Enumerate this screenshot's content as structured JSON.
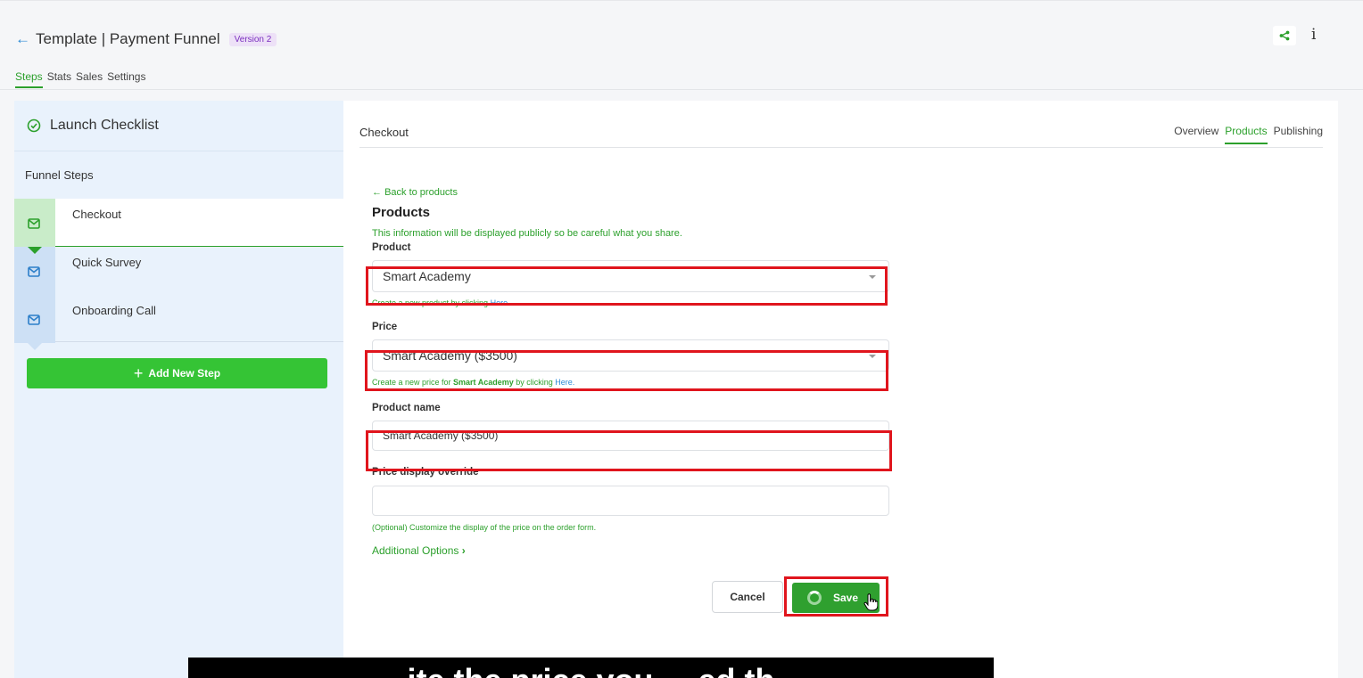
{
  "header": {
    "back_icon": "arrow-left-icon",
    "title": "Template | Payment Funnel",
    "version_badge": "Version 2",
    "tabs": [
      {
        "label": "Steps",
        "active": true
      },
      {
        "label": "Stats",
        "active": false
      },
      {
        "label": "Sales",
        "active": false
      },
      {
        "label": "Settings",
        "active": false
      }
    ],
    "share_icon": "share-icon",
    "info_label": "i"
  },
  "sidebar": {
    "checklist_title": "Launch Checklist",
    "steps_heading": "Funnel Steps",
    "steps": [
      {
        "label": "Checkout",
        "active": true,
        "icon": "mail-icon"
      },
      {
        "label": "Quick Survey",
        "active": false,
        "icon": "mail-icon"
      },
      {
        "label": "Onboarding Call",
        "active": false,
        "icon": "mail-icon"
      }
    ],
    "add_step_label": "Add New Step"
  },
  "main": {
    "step_title": "Checkout",
    "tabs": [
      {
        "label": "Overview",
        "active": false
      },
      {
        "label": "Products",
        "active": true
      },
      {
        "label": "Publishing",
        "active": false
      }
    ],
    "form": {
      "back_link": "Back to products",
      "title": "Products",
      "description": "This information will be displayed publicly so be careful what you share.",
      "product_label": "Product",
      "product_value": "Smart Academy",
      "product_hint_prefix": "Create a new product by clicking ",
      "product_hint_link": "Here.",
      "price_label": "Price",
      "price_value": "Smart Academy ($3500)",
      "price_hint_prefix": "Create a new price for ",
      "price_hint_product": "Smart Academy",
      "price_hint_middle": " by clicking ",
      "price_hint_link": "Here.",
      "product_name_label": "Product name",
      "product_name_value": "Smart Academy ($3500)",
      "price_override_label": "Price display override",
      "price_override_value": "",
      "price_override_hint": "(Optional) Customize the display of the price on the order form.",
      "additional_options": "Additional Options",
      "cancel_label": "Cancel",
      "save_label": "Save"
    }
  },
  "caption": "...ite the price you ... ed th...",
  "colors": {
    "accent_green": "#2ca02c",
    "highlight_red": "#e0151d",
    "sidebar_bg": "#e9f2fc"
  }
}
